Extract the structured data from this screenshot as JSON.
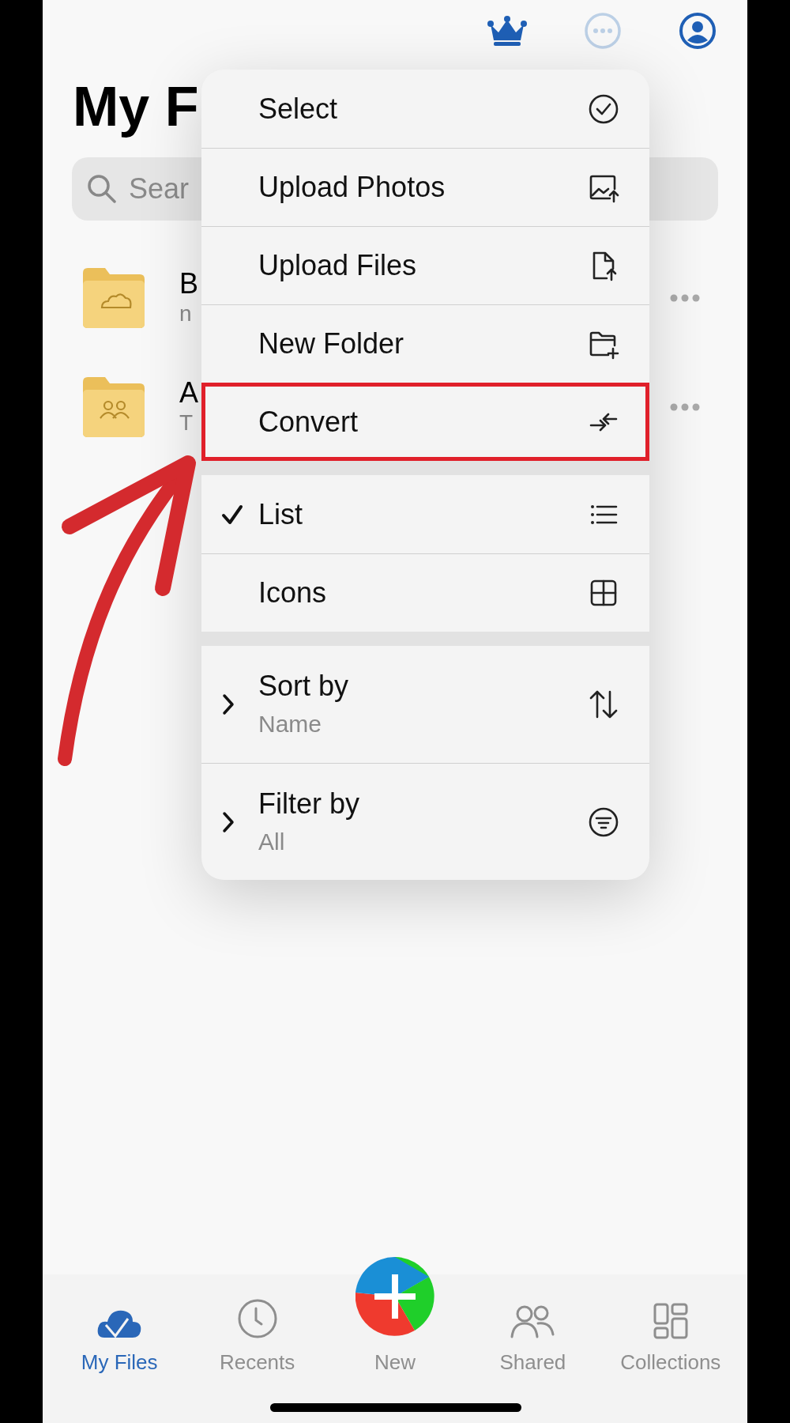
{
  "page_title": "My F",
  "search": {
    "placeholder": "Sear"
  },
  "folders": [
    {
      "name": "B",
      "subtitle": "n"
    },
    {
      "name": "A",
      "subtitle": "T"
    }
  ],
  "menu": {
    "sections": [
      {
        "items": [
          {
            "kind": "action",
            "label": "Select",
            "outlined": false
          },
          {
            "kind": "action",
            "label": "Upload Photos",
            "outlined": false
          },
          {
            "kind": "action",
            "label": "Upload Files",
            "outlined": false
          },
          {
            "kind": "action",
            "label": "New Folder",
            "outlined": false
          },
          {
            "kind": "action",
            "label": "Convert",
            "outlined": true
          }
        ]
      },
      {
        "items": [
          {
            "kind": "option",
            "label": "List",
            "checked": true
          },
          {
            "kind": "option",
            "label": "Icons",
            "checked": false
          }
        ]
      },
      {
        "items": [
          {
            "kind": "submenu",
            "label": "Sort by",
            "value": "Name"
          },
          {
            "kind": "submenu",
            "label": "Filter by",
            "value": "All"
          }
        ]
      }
    ]
  },
  "tab_bar": [
    {
      "kind": "tab",
      "label": "My Files",
      "selected": true
    },
    {
      "kind": "tab",
      "label": "Recents",
      "selected": false
    },
    {
      "kind": "fab",
      "label": "New",
      "selected": false
    },
    {
      "kind": "tab",
      "label": "Shared",
      "selected": false
    },
    {
      "kind": "tab",
      "label": "Collections",
      "selected": false
    }
  ]
}
